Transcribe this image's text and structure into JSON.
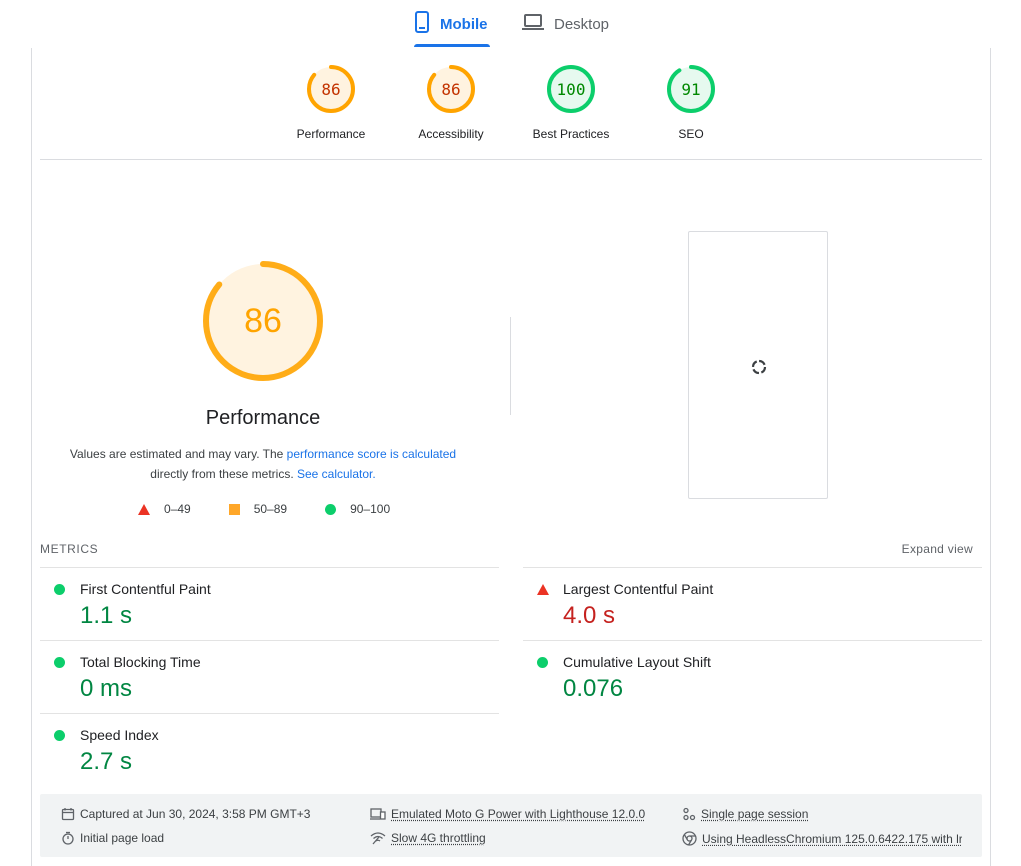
{
  "tabs": {
    "mobile": "Mobile",
    "desktop": "Desktop"
  },
  "categories": [
    {
      "label": "Performance",
      "score": "86",
      "status": "average"
    },
    {
      "label": "Accessibility",
      "score": "86",
      "status": "average"
    },
    {
      "label": "Best Practices",
      "score": "100",
      "status": "pass"
    },
    {
      "label": "SEO",
      "score": "91",
      "status": "pass"
    }
  ],
  "performance": {
    "score": "86",
    "title": "Performance",
    "desc_1": "Values are estimated and may vary. The ",
    "desc_link_1": "performance score is calculated",
    "desc_2": "directly from these metrics. ",
    "desc_link_2": "See calculator."
  },
  "legend": {
    "fail": "0–49",
    "average": "50–89",
    "pass": "90–100"
  },
  "metrics": {
    "title": "METRICS",
    "expand": "Expand view",
    "items": [
      {
        "label": "First Contentful Paint",
        "value": "1.1 s",
        "status": "pass"
      },
      {
        "label": "Largest Contentful Paint",
        "value": "4.0 s",
        "status": "fail"
      },
      {
        "label": "Total Blocking Time",
        "value": "0 ms",
        "status": "pass"
      },
      {
        "label": "Cumulative Layout Shift",
        "value": "0.076",
        "status": "pass"
      },
      {
        "label": "Speed Index",
        "value": "2.7 s",
        "status": "pass"
      }
    ]
  },
  "runtime": {
    "captured": "Captured at Jun 30, 2024, 3:58 PM GMT+3",
    "load": "Initial page load",
    "device": "Emulated Moto G Power with Lighthouse 12.0.0",
    "throttling": "Slow 4G throttling",
    "session": "Single page session",
    "browser": "Using HeadlessChromium 125.0.6422.175 with lr"
  },
  "colors": {
    "accent": "#1a73e8",
    "pass": "#0cce6b",
    "average": "#ffa400",
    "fail": "#eb3324"
  }
}
